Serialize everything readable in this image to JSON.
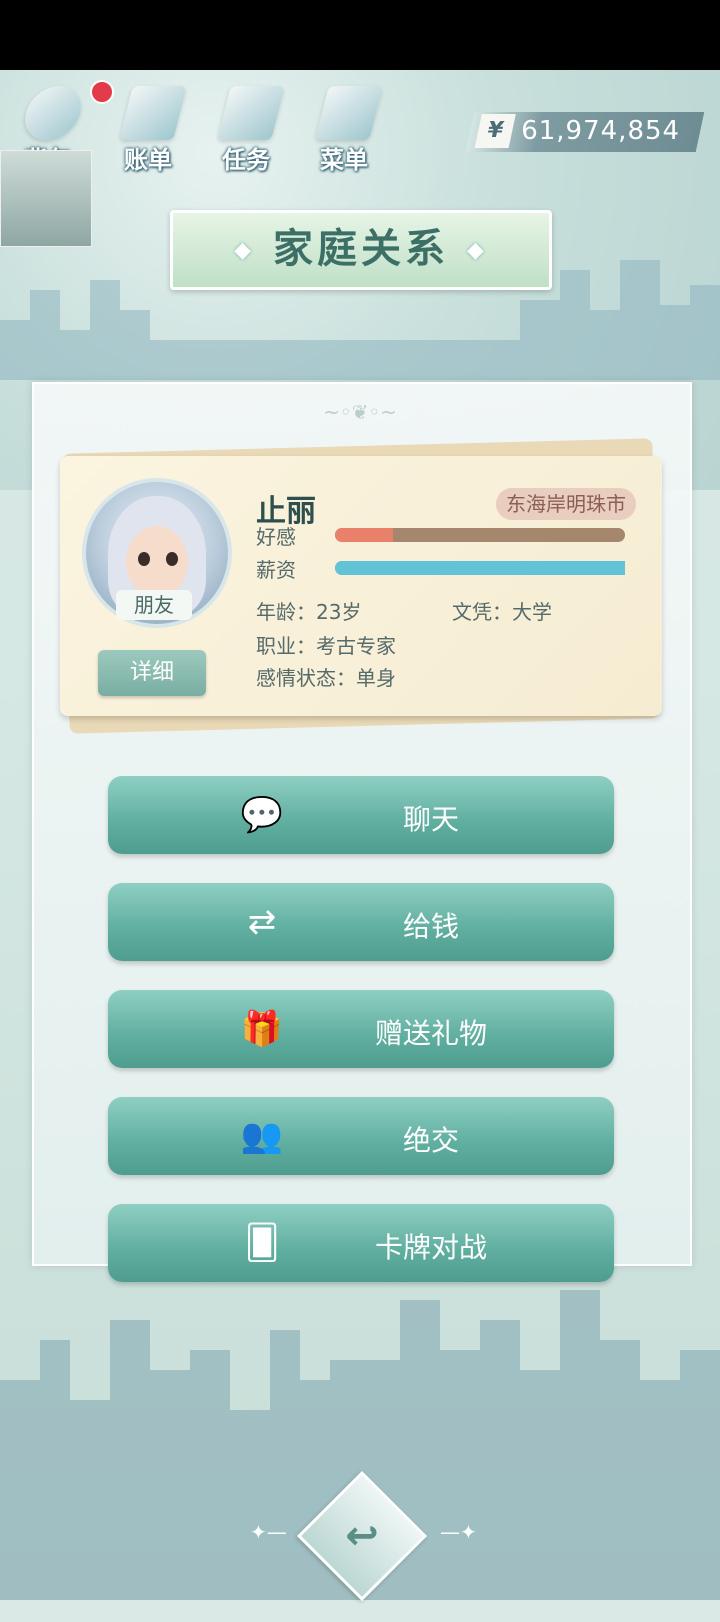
{
  "top_menu": {
    "bag": "背包",
    "bill": "账单",
    "task": "任务",
    "menu": "菜单"
  },
  "money": {
    "currency_icon": "¥",
    "value": "61,974,854"
  },
  "title": "家庭关系",
  "character": {
    "name": "止丽",
    "region": "东海岸明珠市",
    "relation": "朋友",
    "detail_button": "详细",
    "favor_label": "好感",
    "favor_level": 0.2,
    "salary_label": "薪资",
    "salary_level": 1.0,
    "age_text": "年龄：23岁",
    "education_text": "文凭：大学",
    "job_text": "职业：考古专家",
    "status_text": "感情状态：单身"
  },
  "actions": [
    {
      "label": "聊天",
      "icon": "chat-bubble-icon"
    },
    {
      "label": "给钱",
      "icon": "transfer-money-icon"
    },
    {
      "label": "赠送礼物",
      "icon": "gift-icon"
    },
    {
      "label": "绝交",
      "icon": "two-people-icon"
    },
    {
      "label": "卡牌对战",
      "icon": "cards-icon"
    }
  ],
  "colors": {
    "favor_fill": "#e8806a",
    "favor_track": "#a4876d",
    "salary_fill": "#63c3d6",
    "button_teal": "#5fae9f",
    "badge_red": "#e23b4a"
  }
}
